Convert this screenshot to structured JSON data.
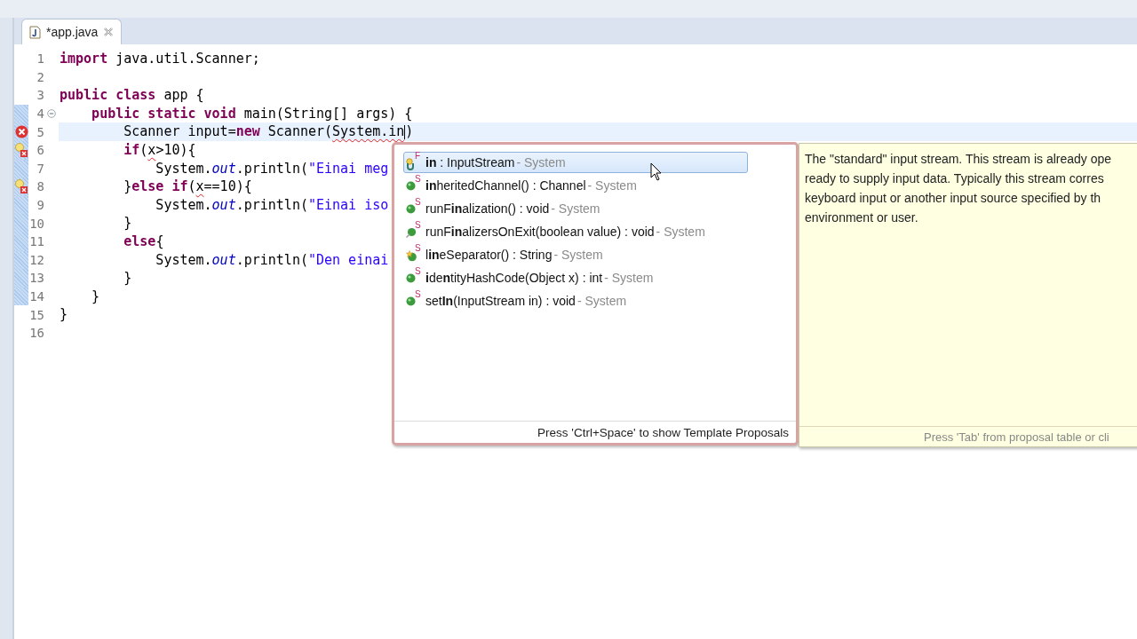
{
  "tab": {
    "label": "*app.java",
    "selected": true
  },
  "editor": {
    "lines": [
      {
        "number": "1",
        "current": false,
        "range": false,
        "foldable": false,
        "error_marker": false,
        "quickfix_marker": false,
        "segments": [
          {
            "text": "import",
            "kind": "kw"
          },
          {
            "text": " java.util.Scanner;",
            "kind": "plain"
          }
        ]
      },
      {
        "number": "2",
        "current": false,
        "range": false,
        "foldable": false,
        "error_marker": false,
        "quickfix_marker": false
      },
      {
        "number": "3",
        "current": false,
        "range": false,
        "foldable": false,
        "error_marker": false,
        "quickfix_marker": false,
        "segments": [
          {
            "text": "public class",
            "kind": "kw"
          },
          {
            "text": " app {",
            "kind": "plain"
          }
        ]
      },
      {
        "number": "4",
        "current": false,
        "range": true,
        "foldable": true,
        "error_marker": false,
        "quickfix_marker": false,
        "segments": [
          {
            "text": "    public static void",
            "kind": "kw"
          },
          {
            "text": " main(String[] args) {",
            "kind": "plain"
          }
        ]
      },
      {
        "number": "5",
        "current": true,
        "range": true,
        "foldable": false,
        "error_marker": true,
        "quickfix_marker": false,
        "segments": [
          {
            "text": "        Scanner input=",
            "kind": "plain"
          },
          {
            "text": "new",
            "kind": "kw"
          },
          {
            "text": " Scanner(",
            "kind": "plain"
          },
          {
            "text": "System.in",
            "kind": "plain",
            "error": true
          },
          {
            "text": ")",
            "kind": "plain"
          }
        ]
      },
      {
        "number": "6",
        "current": false,
        "range": true,
        "foldable": false,
        "error_marker": false,
        "quickfix_marker": true,
        "segments": [
          {
            "text": "        if",
            "kind": "kw"
          },
          {
            "text": "(",
            "kind": "plain"
          },
          {
            "text": "x",
            "kind": "plain",
            "error": true
          },
          {
            "text": ">10){",
            "kind": "plain"
          }
        ]
      },
      {
        "number": "7",
        "current": false,
        "range": true,
        "foldable": false,
        "error_marker": false,
        "quickfix_marker": false,
        "segments": [
          {
            "text": "            System.",
            "kind": "plain"
          },
          {
            "text": "out",
            "kind": "field"
          },
          {
            "text": ".println(",
            "kind": "plain"
          },
          {
            "text": "\"Einai meg",
            "kind": "str"
          }
        ]
      },
      {
        "number": "8",
        "current": false,
        "range": true,
        "foldable": false,
        "error_marker": false,
        "quickfix_marker": true,
        "segments": [
          {
            "text": "        }",
            "kind": "plain"
          },
          {
            "text": "else if",
            "kind": "kw"
          },
          {
            "text": "(",
            "kind": "plain"
          },
          {
            "text": "x",
            "kind": "plain",
            "error": true
          },
          {
            "text": "==10){",
            "kind": "plain"
          }
        ]
      },
      {
        "number": "9",
        "current": false,
        "range": true,
        "foldable": false,
        "error_marker": false,
        "quickfix_marker": false,
        "segments": [
          {
            "text": "            System.",
            "kind": "plain"
          },
          {
            "text": "out",
            "kind": "field"
          },
          {
            "text": ".println(",
            "kind": "plain"
          },
          {
            "text": "\"Einai iso",
            "kind": "str"
          }
        ]
      },
      {
        "number": "10",
        "current": false,
        "range": true,
        "foldable": false,
        "error_marker": false,
        "quickfix_marker": false,
        "segments": [
          {
            "text": "        }",
            "kind": "plain"
          }
        ]
      },
      {
        "number": "11",
        "current": false,
        "range": true,
        "foldable": false,
        "error_marker": false,
        "quickfix_marker": false,
        "segments": [
          {
            "text": "        else",
            "kind": "kw"
          },
          {
            "text": "{",
            "kind": "plain"
          }
        ]
      },
      {
        "number": "12",
        "current": false,
        "range": true,
        "foldable": false,
        "error_marker": false,
        "quickfix_marker": false,
        "segments": [
          {
            "text": "            System.",
            "kind": "plain"
          },
          {
            "text": "out",
            "kind": "field"
          },
          {
            "text": ".println(",
            "kind": "plain"
          },
          {
            "text": "\"Den einai",
            "kind": "str"
          }
        ]
      },
      {
        "number": "13",
        "current": false,
        "range": true,
        "foldable": false,
        "error_marker": false,
        "quickfix_marker": false,
        "segments": [
          {
            "text": "        }",
            "kind": "plain"
          }
        ]
      },
      {
        "number": "14",
        "current": false,
        "range": true,
        "foldable": false,
        "error_marker": false,
        "quickfix_marker": false,
        "segments": [
          {
            "text": "    }",
            "kind": "plain"
          }
        ]
      },
      {
        "number": "15",
        "current": false,
        "range": false,
        "foldable": false,
        "error_marker": false,
        "quickfix_marker": false,
        "segments": [
          {
            "text": "}",
            "kind": "plain"
          }
        ]
      },
      {
        "number": "16",
        "current": false,
        "range": false,
        "foldable": false,
        "error_marker": false,
        "quickfix_marker": false
      }
    ]
  },
  "proposals": {
    "items": [
      {
        "kind": "field",
        "modifier": "F",
        "label": "**in** : InputStream",
        "qualifier": " - System",
        "selected": true
      },
      {
        "kind": "method",
        "modifier": "S",
        "label": "**in**heritedChannel() : Channel",
        "qualifier": " - System",
        "selected": false
      },
      {
        "kind": "method",
        "modifier": "S",
        "label": "runF**in**alization() : void",
        "qualifier": " - System",
        "selected": false
      },
      {
        "kind": "deprecated",
        "modifier": "S",
        "label": "runF**in**alizersOnExit(boolean value) : void",
        "qualifier": " - System",
        "selected": false
      },
      {
        "kind": "new",
        "modifier": "S",
        "label": "l**in**eSeparator() : String",
        "qualifier": " - System",
        "selected": false
      },
      {
        "kind": "method",
        "modifier": "S",
        "label": "**i**de**n**tityHashCode(Object x) : int",
        "qualifier": " - System",
        "selected": false
      },
      {
        "kind": "method",
        "modifier": "S",
        "label": "set**In**(InputStream in) : void",
        "qualifier": " - System",
        "selected": false
      }
    ],
    "footer": "Press 'Ctrl+Space' to show Template Proposals"
  },
  "doc": {
    "lines": [
      "The \"standard\" input stream. This stream is already ope",
      "ready to supply input data. Typically this stream corres",
      "keyboard input or another input source specified by th",
      "environment or user."
    ],
    "footer": "Press 'Tab' from proposal table or cli"
  }
}
